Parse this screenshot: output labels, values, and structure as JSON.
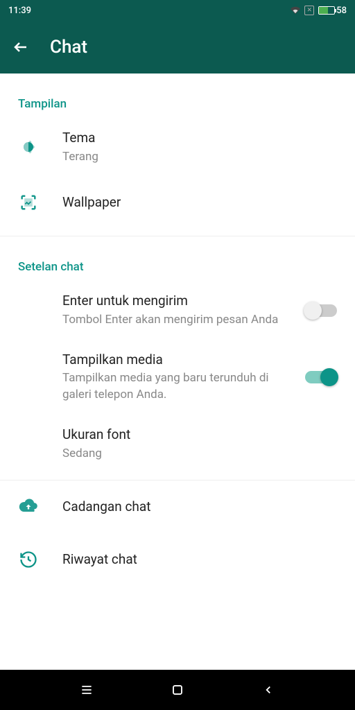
{
  "status": {
    "time": "11:39",
    "battery": "58"
  },
  "header": {
    "title": "Chat"
  },
  "sections": {
    "display": {
      "header": "Tampilan",
      "theme": {
        "title": "Tema",
        "value": "Terang"
      },
      "wallpaper": {
        "title": "Wallpaper"
      }
    },
    "chat": {
      "header": "Setelan chat",
      "enter": {
        "title": "Enter untuk mengirim",
        "sub": "Tombol Enter akan mengirim pesan Anda"
      },
      "media": {
        "title": "Tampilkan media",
        "sub": "Tampilkan media yang baru terunduh di galeri telepon Anda."
      },
      "font": {
        "title": "Ukuran font",
        "value": "Sedang"
      }
    },
    "backup": {
      "title": "Cadangan chat"
    },
    "history": {
      "title": "Riwayat chat"
    }
  }
}
